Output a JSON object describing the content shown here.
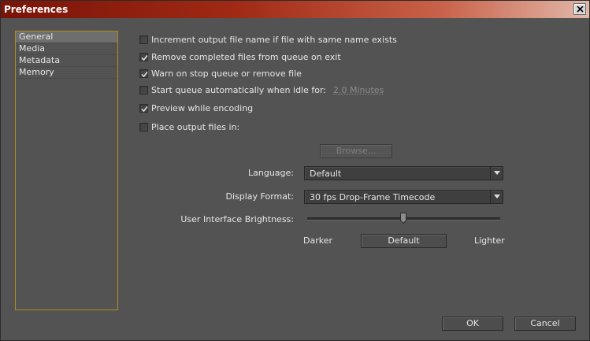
{
  "window": {
    "title": "Preferences"
  },
  "sidebar": {
    "items": [
      {
        "label": "General",
        "selected": true
      },
      {
        "label": "Media",
        "selected": false
      },
      {
        "label": "Metadata",
        "selected": false
      },
      {
        "label": "Memory",
        "selected": false
      }
    ]
  },
  "options": {
    "increment": {
      "label": "Increment output file name if file with same name exists",
      "checked": false
    },
    "remove_completed": {
      "label": "Remove completed files from queue on exit",
      "checked": true
    },
    "warn_on_stop": {
      "label": "Warn on stop queue or remove file",
      "checked": true
    },
    "start_queue": {
      "label": "Start queue automatically when idle for:",
      "checked": false,
      "value": "2.0 Minutes"
    },
    "preview": {
      "label": "Preview while encoding",
      "checked": true
    },
    "place_output": {
      "label": "Place output files in:",
      "checked": false
    }
  },
  "browse": {
    "label": "Browse..."
  },
  "language": {
    "label": "Language:",
    "value": "Default"
  },
  "display_format": {
    "label": "Display Format:",
    "value": "30 fps Drop-Frame Timecode"
  },
  "brightness": {
    "label": "User Interface Brightness:",
    "darker": "Darker",
    "default_button": "Default",
    "lighter": "Lighter",
    "level": 0.5
  },
  "footer": {
    "ok": "OK",
    "cancel": "Cancel"
  },
  "colors": {
    "sidebar_border": "#b48a1f",
    "background": "#535353",
    "title_start": "#7a1308"
  }
}
